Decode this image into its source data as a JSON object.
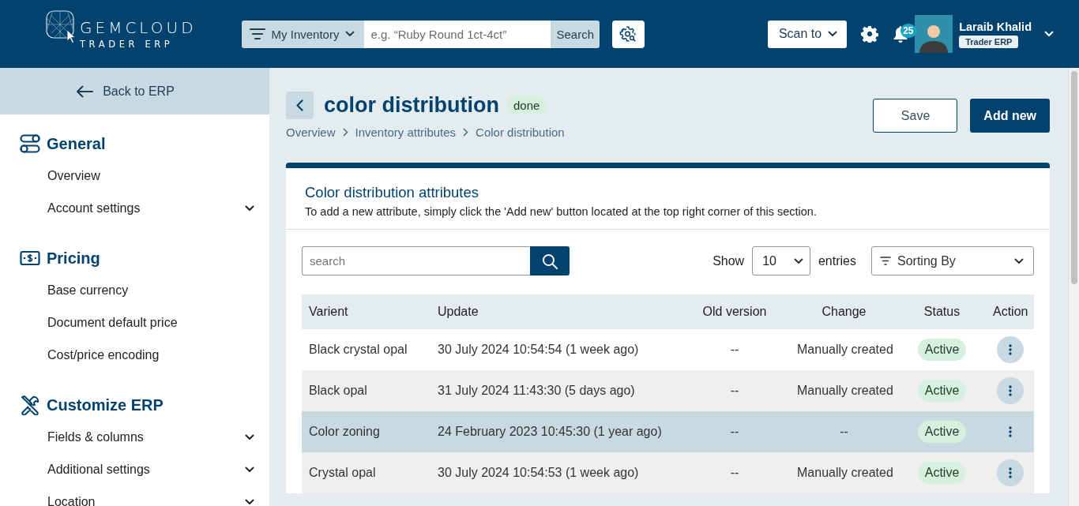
{
  "header": {
    "logo": {
      "name": "GEMCLOUD",
      "tagline": "TRADER ERP"
    },
    "search": {
      "scope": "My Inventory",
      "placeholder": "e.g. “Ruby Round 1ct-4ct”",
      "button": "Search"
    },
    "scan": "Scan to",
    "notifications": "25",
    "user": {
      "name": "Laraib Khalid",
      "role": "Trader ERP"
    }
  },
  "sidebar": {
    "back": "Back to ERP",
    "sections": [
      {
        "title": "General",
        "items": [
          {
            "label": "Overview",
            "kind": "link"
          },
          {
            "label": "Account settings",
            "kind": "group"
          }
        ]
      },
      {
        "title": "Pricing",
        "items": [
          {
            "label": "Base currency",
            "kind": "link"
          },
          {
            "label": "Document default price",
            "kind": "link"
          },
          {
            "label": "Cost/price encoding",
            "kind": "link"
          }
        ]
      },
      {
        "title": "Customize ERP",
        "items": [
          {
            "label": "Fields & columns",
            "kind": "group"
          },
          {
            "label": "Additional settings",
            "kind": "group"
          },
          {
            "label": "Location",
            "kind": "group"
          }
        ]
      }
    ]
  },
  "page": {
    "title": "color distribution",
    "status": "done",
    "breadcrumbs": [
      "Overview",
      "Inventory attributes",
      "Color distribution"
    ],
    "save": "Save",
    "add": "Add new"
  },
  "card": {
    "title": "Color distribution attributes",
    "description": "To add a new attribute, simply click the 'Add new' button located at the top right corner of this section.",
    "search": {
      "placeholder": "search"
    },
    "show_label": "Show",
    "page_size": "10",
    "entries_label": "entries",
    "sort": "Sorting By",
    "table": {
      "columns": [
        "Varient",
        "Update",
        "Old version",
        "Change",
        "Status",
        "Action"
      ],
      "rows": [
        {
          "variant": "Black crystal opal",
          "update": "30 July 2024 10:54:54 (1 week ago)",
          "old_version": "--",
          "change": "Manually created",
          "status": "Active",
          "selected": false
        },
        {
          "variant": "Black opal",
          "update": "31 July 2024 11:43:30 (5 days ago)",
          "old_version": "--",
          "change": "Manually created",
          "status": "Active",
          "selected": false
        },
        {
          "variant": "Color zoning",
          "update": "24 February 2023 10:45:30 (1 year ago)",
          "old_version": "--",
          "change": "--",
          "status": "Active",
          "selected": true
        },
        {
          "variant": "Crystal opal",
          "update": "30 July 2024 10:54:53 (1 week ago)",
          "old_version": "--",
          "change": "Manually created",
          "status": "Active",
          "selected": false
        }
      ]
    }
  }
}
